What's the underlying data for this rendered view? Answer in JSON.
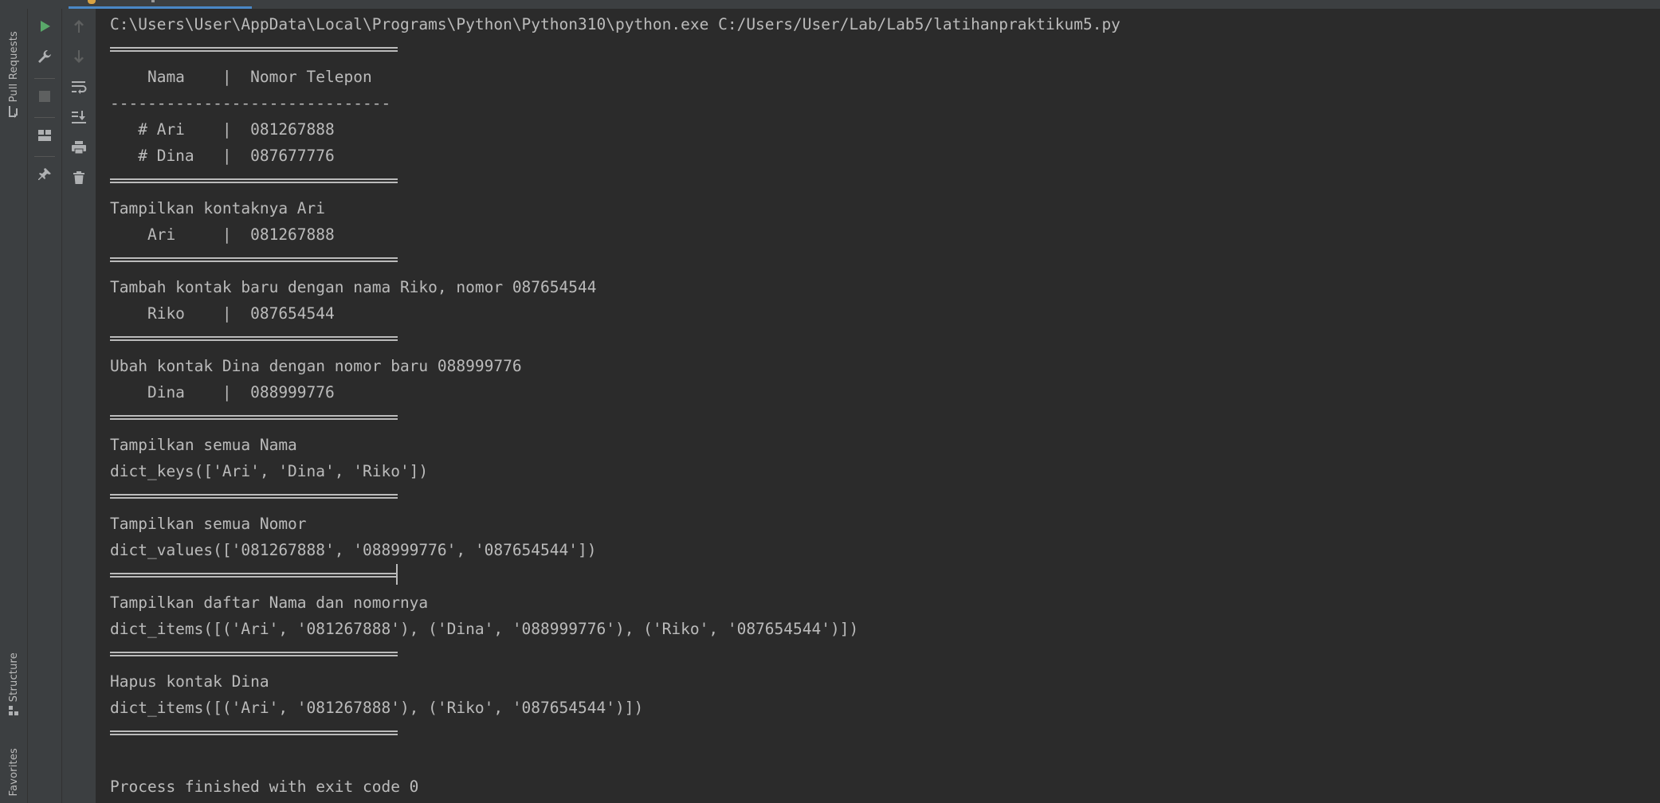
{
  "sidebar": {
    "pull_requests": "Pull Requests",
    "structure": "Structure",
    "favorites": "Favorites"
  },
  "icons": {
    "run": "run-icon",
    "wrench": "wrench-icon",
    "stop": "stop-icon",
    "layout": "layout-icon",
    "pin": "pin-icon",
    "up": "arrow-up-icon",
    "down": "arrow-down-icon",
    "wrap": "soft-wrap-icon",
    "scroll": "scroll-to-end-icon",
    "print": "print-icon",
    "trash": "trash-icon"
  },
  "colors": {
    "run": "#59a869",
    "text": "#bbbbbb",
    "background": "#2b2b2b",
    "panel": "#3c3f41",
    "tab_underline": "#4a88c7"
  },
  "console": {
    "command": "C:\\Users\\User\\AppData\\Local\\Programs\\Python\\Python310\\python.exe C:/Users/User/Lab/Lab5/latihanpraktikum5.py",
    "header": "    Nama    |  Nomor Telepon",
    "dash_line": "------------------------------",
    "row1": "   # Ari    |  081267888",
    "row2": "   # Dina   |  087677776",
    "show_ari_title": "Tampilkan kontaknya Ari",
    "show_ari_row": "    Ari     |  081267888",
    "add_title": "Tambah kontak baru dengan nama Riko, nomor 087654544",
    "add_row": "    Riko    |  087654544",
    "update_title": "Ubah kontak Dina dengan nomor baru 088999776",
    "update_row": "    Dina    |  088999776",
    "names_title": "Tampilkan semua Nama",
    "names_value": "dict_keys(['Ari', 'Dina', 'Riko'])",
    "numbers_title": "Tampilkan semua Nomor",
    "numbers_value": "dict_values(['081267888', '088999776', '087654544'])",
    "items_title": "Tampilkan daftar Nama dan nomornya",
    "items_value": "dict_items([('Ari', '081267888'), ('Dina', '088999776'), ('Riko', '087654544')])",
    "delete_title": "Hapus kontak Dina",
    "delete_value": "dict_items([('Ari', '081267888'), ('Riko', '087654544')])",
    "finished": "Process finished with exit code 0"
  }
}
